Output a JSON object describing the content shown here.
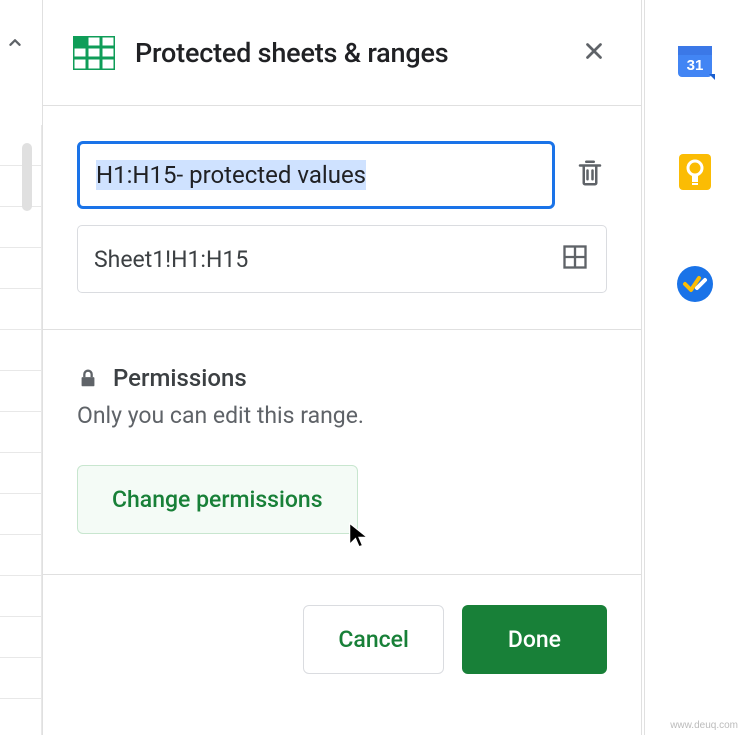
{
  "panel": {
    "title": "Protected sheets & ranges",
    "description_value": "H1:H15- protected values",
    "range_value": "Sheet1!H1:H15"
  },
  "permissions": {
    "heading": "Permissions",
    "description": "Only you can edit this range.",
    "change_button": "Change permissions"
  },
  "footer": {
    "cancel": "Cancel",
    "done": "Done"
  },
  "right_rail": {
    "calendar_day": "31"
  },
  "watermark": "www.deuq.com"
}
